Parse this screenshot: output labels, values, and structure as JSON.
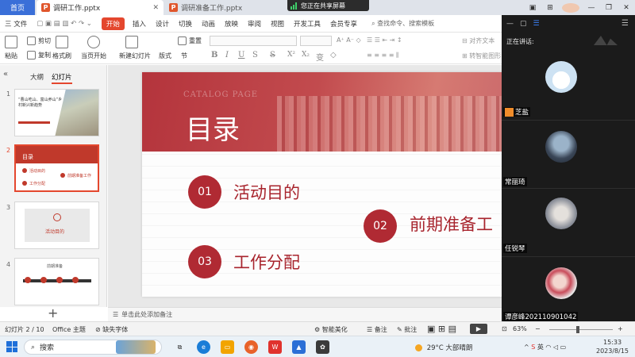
{
  "tabs": {
    "home": "首页",
    "files": [
      {
        "name": "调研工作.pptx"
      },
      {
        "name": "调研准备工作.pptx"
      }
    ],
    "share_banner": "您正在共享屏幕"
  },
  "menu": {
    "file": "三 文件",
    "items": [
      "开始",
      "插入",
      "设计",
      "切换",
      "动画",
      "放映",
      "审阅",
      "视图",
      "开发工具",
      "会员专享"
    ],
    "search_placeholder": "查找命令、搜索模板"
  },
  "ribbon": {
    "paste": "粘贴",
    "cut": "剪切",
    "copy": "复制",
    "format_painter": "格式刷",
    "from_current": "当页开始",
    "new_slide": "新建幻灯片",
    "layout": "版式",
    "section": "节",
    "reset": "重置",
    "align_text": "对齐文本",
    "convert_smartart": "转智能图形"
  },
  "left_pane": {
    "tab_outline": "大纲",
    "tab_slides": "幻灯片",
    "thumbs": [
      {
        "num": "1",
        "title": "“曹山吃山、富山养山”乡村新兴新趋势"
      },
      {
        "num": "2",
        "title": "目录",
        "items": [
          "活动目的",
          "前期准备工作",
          "工作分配"
        ]
      },
      {
        "num": "3",
        "title": "活动目的"
      },
      {
        "num": "4",
        "title": "前期准备"
      }
    ],
    "add": "+"
  },
  "slide": {
    "catalog": "CATALOG PAGE",
    "title": "目录",
    "items": [
      {
        "num": "01",
        "text": "活动目的"
      },
      {
        "num": "02",
        "text": "前期准备工"
      },
      {
        "num": "03",
        "text": "工作分配"
      }
    ],
    "notes_placeholder": "单击此处添加备注"
  },
  "video_panel": {
    "speaking_label": "正在讲话:",
    "participants": [
      {
        "name": "芝盐"
      },
      {
        "name": "常丽琦"
      },
      {
        "name": "任锐琴"
      },
      {
        "name": "谭彦峰202110901042"
      }
    ]
  },
  "status_bar": {
    "slide_info": "幻灯片 2 / 10",
    "theme": "Office 主题",
    "missing_font": "缺失字体",
    "smart_beautify": "智能美化",
    "notes": "备注",
    "comments": "批注",
    "zoom": "63%"
  },
  "taskbar": {
    "search": "搜索",
    "weather_temp": "29°C",
    "weather_desc": "大部晴朗",
    "ime": "英",
    "time": "15:33",
    "date": "2023/8/15"
  },
  "colors": {
    "accent_red": "#b02a33",
    "wps_blue": "#3a6fd8",
    "ppt_orange": "#e0562c"
  }
}
